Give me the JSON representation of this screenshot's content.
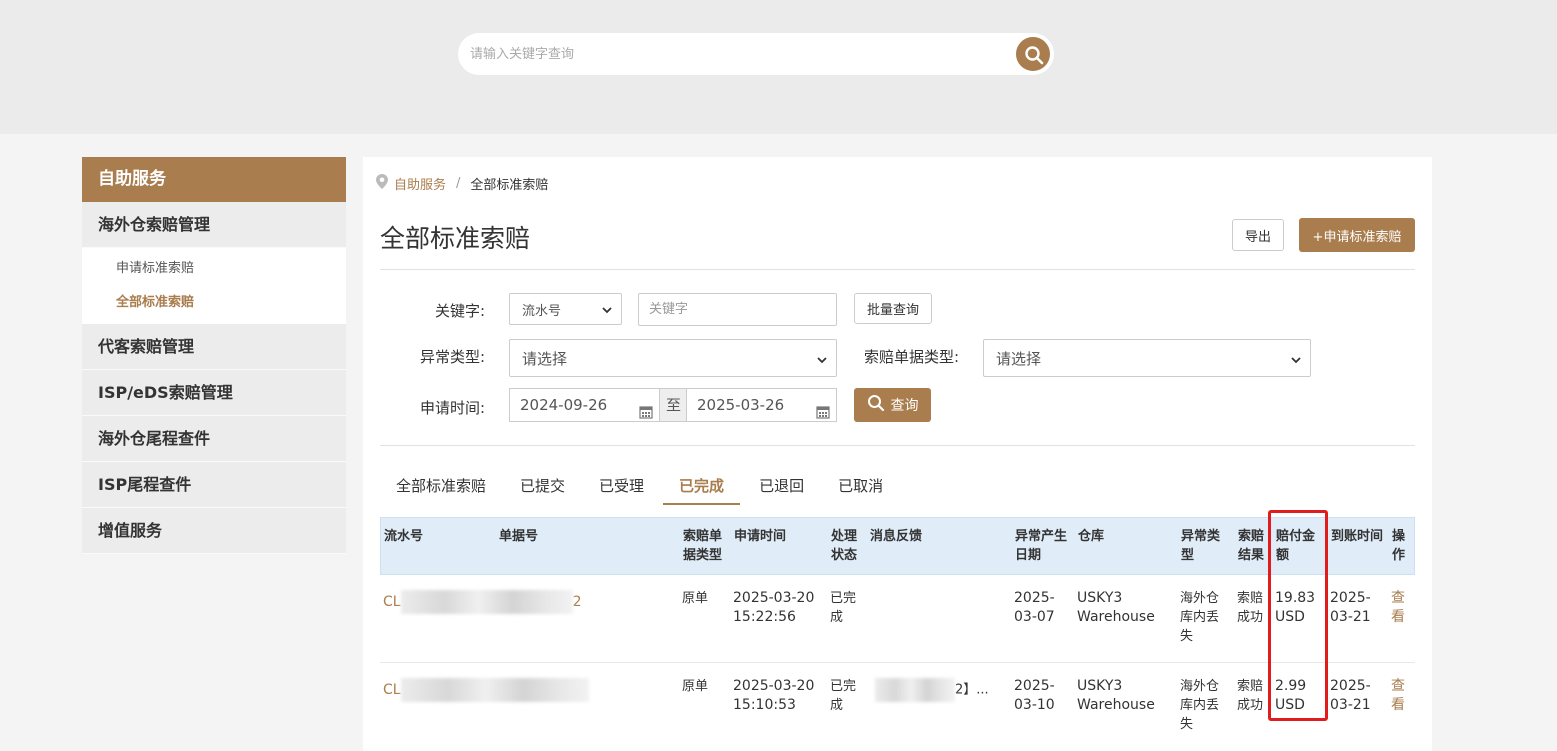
{
  "search": {
    "placeholder": "请输入关键字查询"
  },
  "sidebar": {
    "header": "自助服务",
    "group1": "海外仓索赔管理",
    "sub_items": [
      "申请标准索赔",
      "全部标准索赔"
    ],
    "groups": [
      "代客索赔管理",
      "ISP/eDS索赔管理",
      "海外仓尾程查件",
      "ISP尾程查件",
      "增值服务"
    ]
  },
  "breadcrumb": {
    "home": "自助服务",
    "sep": "/",
    "current": "全部标准索赔"
  },
  "page": {
    "title": "全部标准索赔",
    "export_label": "导出",
    "apply_label": "+申请标准索赔"
  },
  "filters": {
    "keyword_label": "关键字:",
    "keyword_type": "流水号",
    "keyword_placeholder": "关键字",
    "batch_label": "批量查询",
    "anomaly_label": "异常类型:",
    "anomaly_value": "请选择",
    "doc_type_label": "索赔单据类型:",
    "doc_type_value": "请选择",
    "date_label": "申请时间:",
    "date_from": "2024-09-26",
    "date_to_sep": "至",
    "date_to": "2025-03-26",
    "query_label": "查询"
  },
  "tabs": [
    "全部标准索赔",
    "已提交",
    "已受理",
    "已完成",
    "已退回",
    "已取消"
  ],
  "active_tab": "已完成",
  "table": {
    "headers": {
      "serial": "流水号",
      "doc_no": "单据号",
      "doc_type": [
        "索赔单",
        "据类型"
      ],
      "apply_time": "申请时间",
      "status": [
        "处理",
        "状态"
      ],
      "feedback": "消息反馈",
      "anomaly_date": [
        "异常产生",
        "日期"
      ],
      "warehouse": "仓库",
      "anomaly_type": [
        "异常类",
        "型"
      ],
      "result": [
        "索赔",
        "结果"
      ],
      "amount": [
        "赔付金",
        "额"
      ],
      "arrival": "到账时间",
      "op": [
        "操",
        "作"
      ]
    },
    "rows": [
      {
        "serial_prefix": "CL",
        "serial_suffix": "2",
        "doc_type": "原单",
        "apply_date": "2025-03-20",
        "apply_clock": "15:22:56",
        "status": [
          "已完",
          "成"
        ],
        "feedback": "",
        "anomaly_date": [
          "2025-",
          "03-07"
        ],
        "warehouse": [
          "USKY3",
          "Warehouse"
        ],
        "anomaly_type": [
          "海外仓",
          "库内丢",
          "失"
        ],
        "result": [
          "索赔",
          "成功"
        ],
        "amount": [
          "19.83",
          "USD"
        ],
        "arrival": [
          "2025-",
          "03-21"
        ],
        "op": [
          "查",
          "看"
        ]
      },
      {
        "serial_prefix": "CL",
        "serial_suffix": "",
        "doc_type": "原单",
        "apply_date": "2025-03-20",
        "apply_clock": "15:10:53",
        "status": [
          "已完",
          "成"
        ],
        "feedback": "2】...",
        "anomaly_date": [
          "2025-",
          "03-10"
        ],
        "warehouse": [
          "USKY3",
          "Warehouse"
        ],
        "anomaly_type": [
          "海外仓",
          "库内丢",
          "失"
        ],
        "result": [
          "索赔",
          "成功"
        ],
        "amount": [
          "2.99",
          "USD"
        ],
        "arrival": [
          "2025-",
          "03-21"
        ],
        "op": [
          "查",
          "看"
        ]
      }
    ]
  },
  "colors": {
    "accent": "#a97d4d",
    "highlight": "#e11c1c",
    "table_header": "#e0edf9"
  },
  "icons": [
    "search-icon",
    "location-pin-icon",
    "chevron-down-icon",
    "calendar-icon"
  ]
}
